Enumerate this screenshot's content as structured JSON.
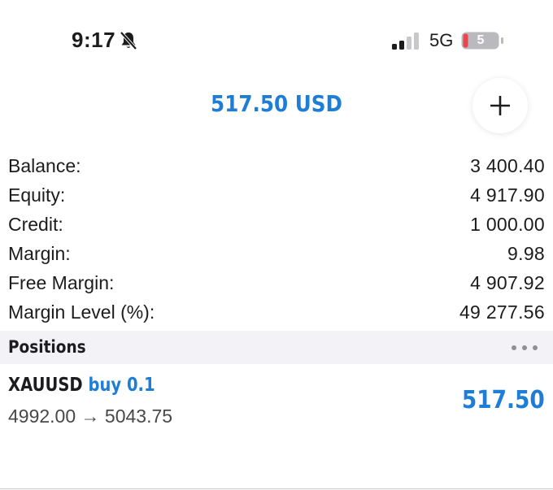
{
  "status_bar": {
    "time": "9:17",
    "network": "5G",
    "battery_level": "5",
    "icons": {
      "silent": "bell-slash-icon",
      "signal": "cellular-signal-icon",
      "battery": "battery-icon"
    },
    "signal_bars_active": 2,
    "signal_bars_total": 4
  },
  "header": {
    "profit": "517.50 USD",
    "add_icon": "plus-icon"
  },
  "account": [
    {
      "label": "Balance:",
      "value": "3 400.40"
    },
    {
      "label": "Equity:",
      "value": "4 917.90"
    },
    {
      "label": "Credit:",
      "value": "1 000.00"
    },
    {
      "label": "Margin:",
      "value": "9.98"
    },
    {
      "label": "Free Margin:",
      "value": "4 907.92"
    },
    {
      "label": "Margin Level (%):",
      "value": "49 277.56"
    }
  ],
  "positions": {
    "title": "Positions",
    "more_icon": "more-horizontal-icon",
    "items": [
      {
        "symbol": "XAUUSD",
        "direction": "buy 0.1",
        "prices": "4992.00 → 5043.75",
        "profit": "517.50"
      }
    ]
  },
  "colors": {
    "accent": "#1e7ed6",
    "text": "#1c1c1e",
    "secondary_text": "#48484a",
    "section_bg": "#f2f2f7",
    "battery_low": "#e5484d"
  }
}
